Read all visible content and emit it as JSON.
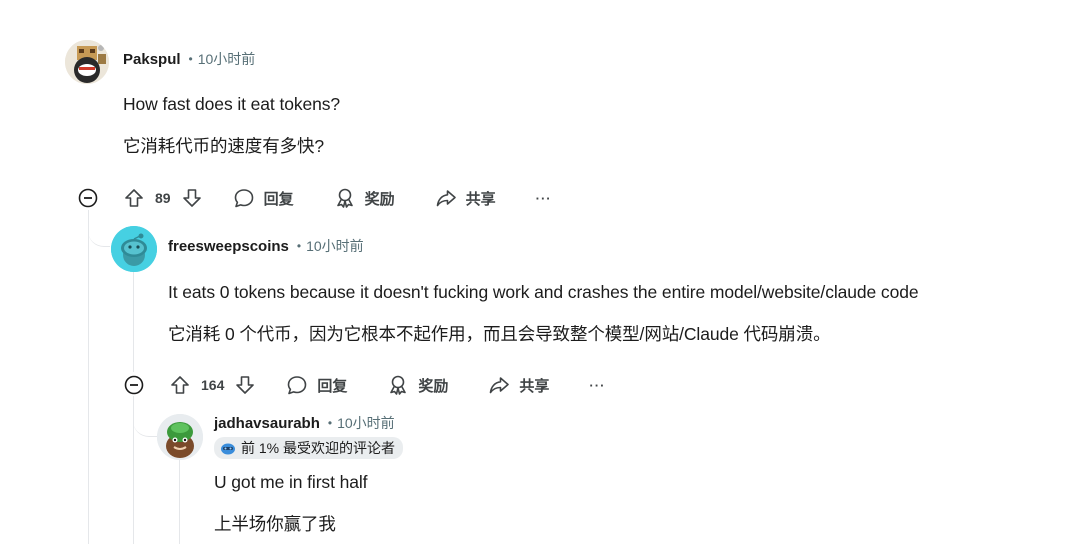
{
  "comments": [
    {
      "author": "Pakspul",
      "separator": "•",
      "time": "10小时前",
      "text_en": "How fast does it eat tokens?",
      "text_zh": "它消耗代币的速度有多快?",
      "score": "89",
      "reply_label": "回复",
      "award_label": "奖励",
      "share_label": "共享",
      "more_label": "···"
    },
    {
      "author": "freesweepscoins",
      "separator": "•",
      "time": "10小时前",
      "text_en": "It eats 0 tokens because it doesn't fucking work and crashes the entire model/website/claude code",
      "text_zh": "它消耗 0 个代币，因为它根本不起作用，而且会导致整个模型/网站/Claude 代码崩溃。",
      "score": "164",
      "reply_label": "回复",
      "award_label": "奖励",
      "share_label": "共享",
      "more_label": "···"
    },
    {
      "author": "jadhavsaurabh",
      "separator": "•",
      "time": "10小时前",
      "flair": "前 1% 最受欢迎的评论者",
      "text_en": "U got me in first half",
      "text_zh": "上半场你赢了我"
    }
  ],
  "colors": {
    "text": "#1c1c1c",
    "meta": "#576f76",
    "action": "#404446",
    "thread_line": "#e5e7ea",
    "flair_bg": "#eaedef"
  }
}
